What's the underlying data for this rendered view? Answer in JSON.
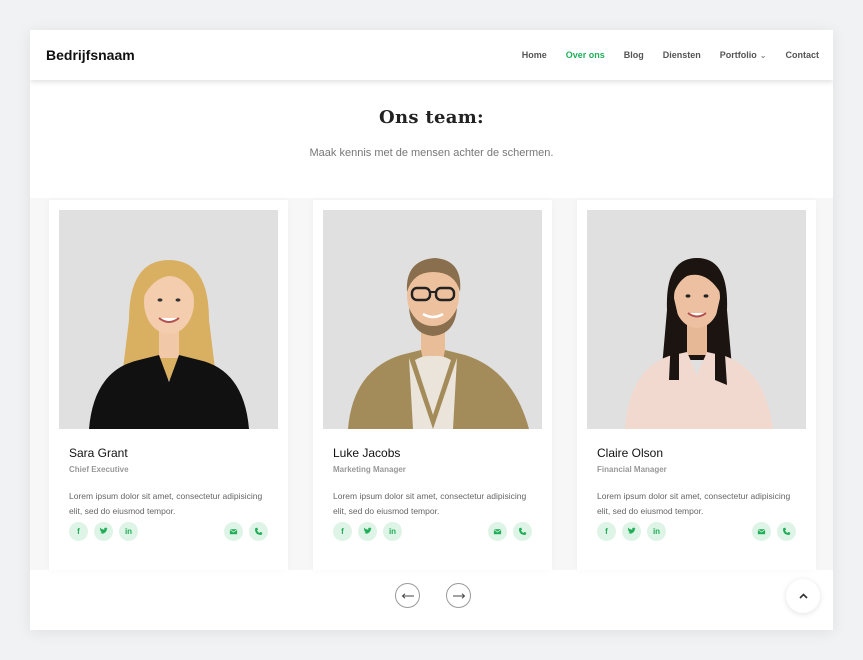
{
  "navbar": {
    "brand": "Bedrijfsnaam",
    "items": [
      {
        "label": "Home"
      },
      {
        "label": "Over ons"
      },
      {
        "label": "Blog"
      },
      {
        "label": "Diensten"
      },
      {
        "label": "Portfolio"
      },
      {
        "label": "Contact"
      }
    ],
    "active_item": "Over ons"
  },
  "section": {
    "title": "Ons team:",
    "subtitle": "Maak kennis met de mensen achter de schermen."
  },
  "team": [
    {
      "name": "Sara Grant",
      "role": "Chief Executive",
      "bio": "Lorem ipsum dolor sit amet, consectetur adipisicing elit, sed do eiusmod tempor.",
      "shirt_color": "#111111",
      "hair_color": "#d9b062"
    },
    {
      "name": "Luke Jacobs",
      "role": "Marketing Manager",
      "bio": "Lorem ipsum dolor sit amet, consectetur adipisicing elit, sed do eiusmod tempor.",
      "shirt_color": "#a48b5a",
      "hair_color": "#8a6f4e"
    },
    {
      "name": "Claire Olson",
      "role": "Financial Manager",
      "bio": "Lorem ipsum dolor sit amet, consectetur adipisicing elit, sed do eiusmod tempor.",
      "shirt_color": "#f2d9d0",
      "hair_color": "#1b1410"
    }
  ],
  "social_icons": [
    "facebook-icon",
    "twitter-icon",
    "linkedin-icon",
    "envelope-icon",
    "phone-icon"
  ],
  "colors": {
    "accent": "#1fb15a",
    "icon_bg": "#ddf4e6",
    "photo_bg": "#e0e0e0"
  },
  "carousel": {
    "prev_icon": "arrow-left-icon",
    "next_icon": "arrow-right-icon"
  },
  "back_to_top_icon": "chevron-up-icon"
}
